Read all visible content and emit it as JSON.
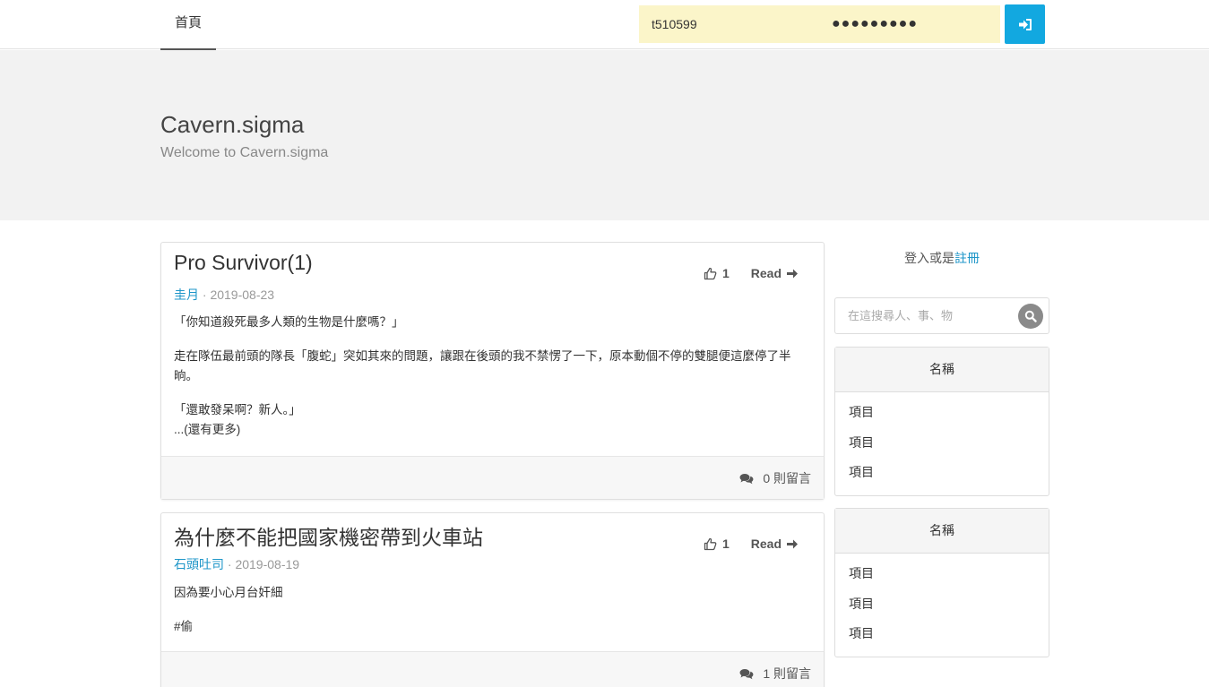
{
  "nav": {
    "home_label": "首頁",
    "username_value": "t510599",
    "password_value": "●●●●●●●●●"
  },
  "hero": {
    "title": "Cavern.sigma",
    "subtitle": "Welcome to Cavern.sigma"
  },
  "posts": [
    {
      "title": "Pro Survivor(1)",
      "author": "圭月",
      "date": "2019-08-23",
      "likes": "1",
      "read_label": "Read",
      "paragraphs": [
        "「你知道殺死最多人類的生物是什麼嗎？」",
        "走在隊伍最前頭的隊長「腹蛇」突如其來的問題，讓跟在後頭的我不禁愣了一下，原本動個不停的雙腿便這麼停了半晌。",
        "「還敢發呆啊？新人。」",
        "...(還有更多)"
      ],
      "comments": "0 則留言"
    },
    {
      "title": "為什麼不能把國家機密帶到火車站",
      "author": "石頭吐司",
      "date": "2019-08-19",
      "likes": "1",
      "read_label": "Read",
      "paragraphs": [
        "因為要小心月台奸細",
        "#偷"
      ],
      "comments": "1 則留言"
    }
  ],
  "sidebar": {
    "login_text": "登入或是",
    "register_link": "註冊",
    "search_placeholder": "在這搜尋人、事、物",
    "panels": [
      {
        "title": "名稱",
        "items": [
          "項目",
          "項目",
          "項目"
        ]
      },
      {
        "title": "名稱",
        "items": [
          "項目",
          "項目",
          "項目"
        ]
      }
    ]
  },
  "colors": {
    "accent": "#12a8e0",
    "link": "#1e96c8",
    "autofill": "#fbf5c9",
    "hero_bg": "#f2f2f2"
  }
}
